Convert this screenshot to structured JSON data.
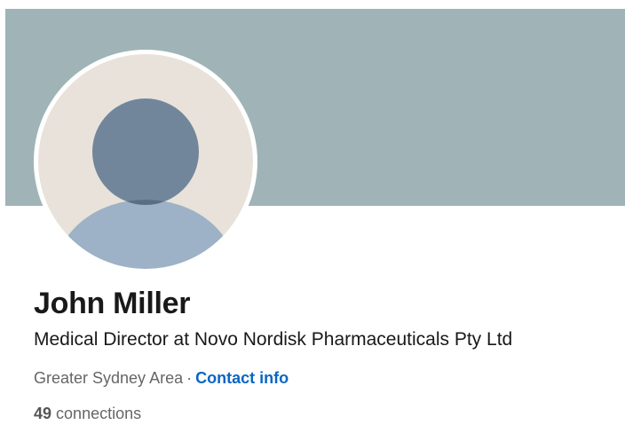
{
  "profile": {
    "name": "John Miller",
    "headline": "Medical Director at Novo Nordisk Pharmaceuticals Pty Ltd",
    "location": "Greater Sydney Area",
    "separator": "·",
    "contact_info_label": "Contact info",
    "connections_count": "49",
    "connections_label": "connections"
  },
  "colors": {
    "cover": "#a0b4b7",
    "avatar_background": "#e8e2da",
    "avatar_head": "#71869a",
    "avatar_body": "#9db1c7",
    "link": "#0a66c2"
  },
  "icons": {
    "avatar": "default-person-silhouette-icon"
  }
}
